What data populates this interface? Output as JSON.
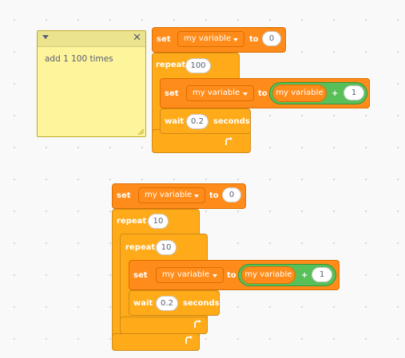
{
  "comment": {
    "text": "add 1 100 times"
  },
  "script1": {
    "set_block": {
      "keyword": "set",
      "variable": "my variable",
      "to_word": "to",
      "value": "0"
    },
    "repeat_block": {
      "keyword": "repeat",
      "count": "100"
    },
    "inner_set_block": {
      "keyword": "set",
      "variable": "my variable",
      "to_word": "to",
      "reporter": "my variable",
      "operator": "+",
      "value": "1"
    },
    "wait_block": {
      "keyword": "wait",
      "value": "0.2",
      "unit": "seconds"
    }
  },
  "script2": {
    "set_block": {
      "keyword": "set",
      "variable": "my variable",
      "to_word": "to",
      "value": "0"
    },
    "outer_repeat_block": {
      "keyword": "repeat",
      "count": "10"
    },
    "inner_repeat_block": {
      "keyword": "repeat",
      "count": "10"
    },
    "inner_set_block": {
      "keyword": "set",
      "variable": "my variable",
      "to_word": "to",
      "reporter": "my variable",
      "operator": "+",
      "value": "1"
    },
    "wait_block": {
      "keyword": "wait",
      "value": "0.2",
      "unit": "seconds"
    }
  },
  "colors": {
    "variables_block": "#ff8c1a",
    "control_block": "#ffab19",
    "operator_block": "#59c059",
    "comment_body": "#fef49c"
  }
}
